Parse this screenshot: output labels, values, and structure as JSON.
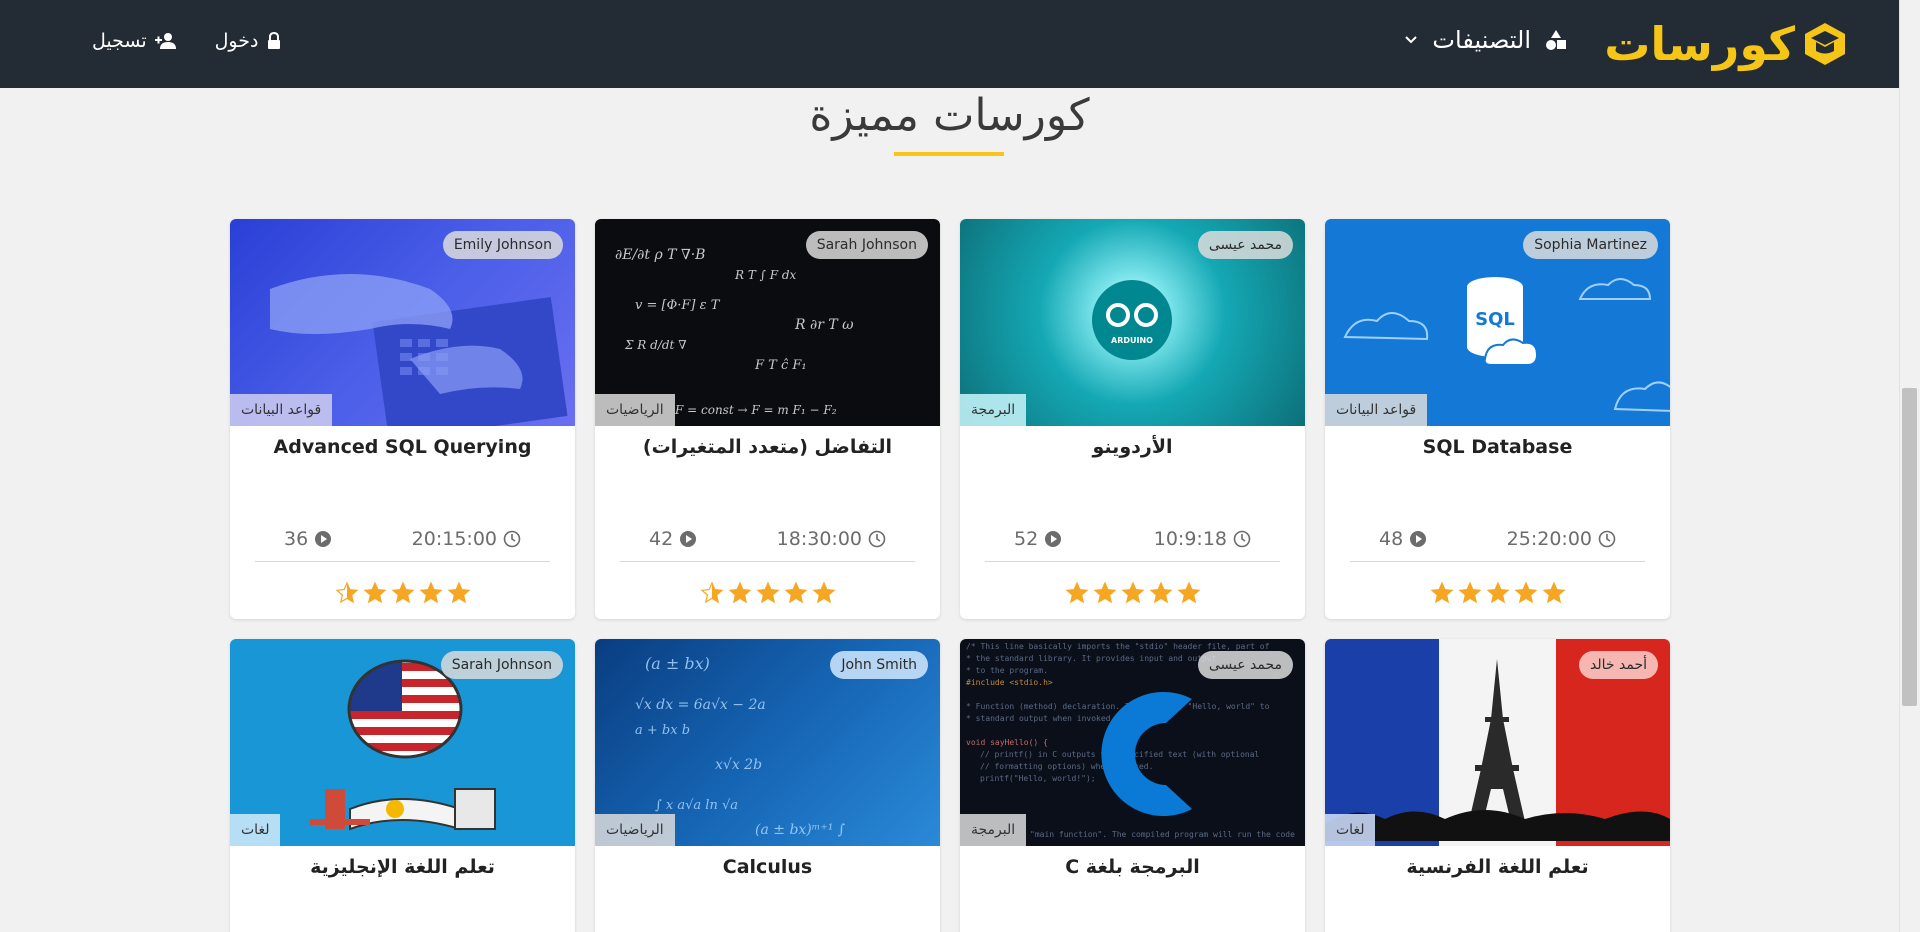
{
  "navbar": {
    "brand": "كورسات",
    "categories_label": "التصنيفات",
    "login_label": "دخول",
    "register_label": "تسجيل"
  },
  "section": {
    "title": "كورسات مميزة"
  },
  "colors": {
    "accent": "#f5c518",
    "navbar": "#232b34",
    "star": "#f5a623"
  },
  "cards": [
    {
      "title": "SQL Database",
      "author": "Sophia Martinez",
      "category": "قواعد البيانات",
      "duration": "25:20:00",
      "lessons": "48",
      "rating": 5
    },
    {
      "title": "الأردوينو",
      "author": "محمد عيسى",
      "category": "البرمجة",
      "duration": "10:9:18",
      "lessons": "52",
      "rating": 5
    },
    {
      "title": "التفاضل (متعدد المتغيرات)",
      "author": "Sarah Johnson",
      "category": "الرياضيات",
      "duration": "18:30:00",
      "lessons": "42",
      "rating": 4.5
    },
    {
      "title": "Advanced SQL Querying",
      "author": "Emily Johnson",
      "category": "قواعد البيانات",
      "duration": "20:15:00",
      "lessons": "36",
      "rating": 4.5
    },
    {
      "title": "تعلم اللغة الفرنسية",
      "author": "أحمد خالد",
      "category": "لغات"
    },
    {
      "title": "البرمجة بلغة C",
      "author": "محمد عيسى",
      "category": "البرمجة"
    },
    {
      "title": "Calculus",
      "author": "John Smith",
      "category": "الرياضيات"
    },
    {
      "title": "تعلم اللغة الإنجليزية",
      "author": "Sarah Johnson",
      "category": "لغات"
    }
  ]
}
